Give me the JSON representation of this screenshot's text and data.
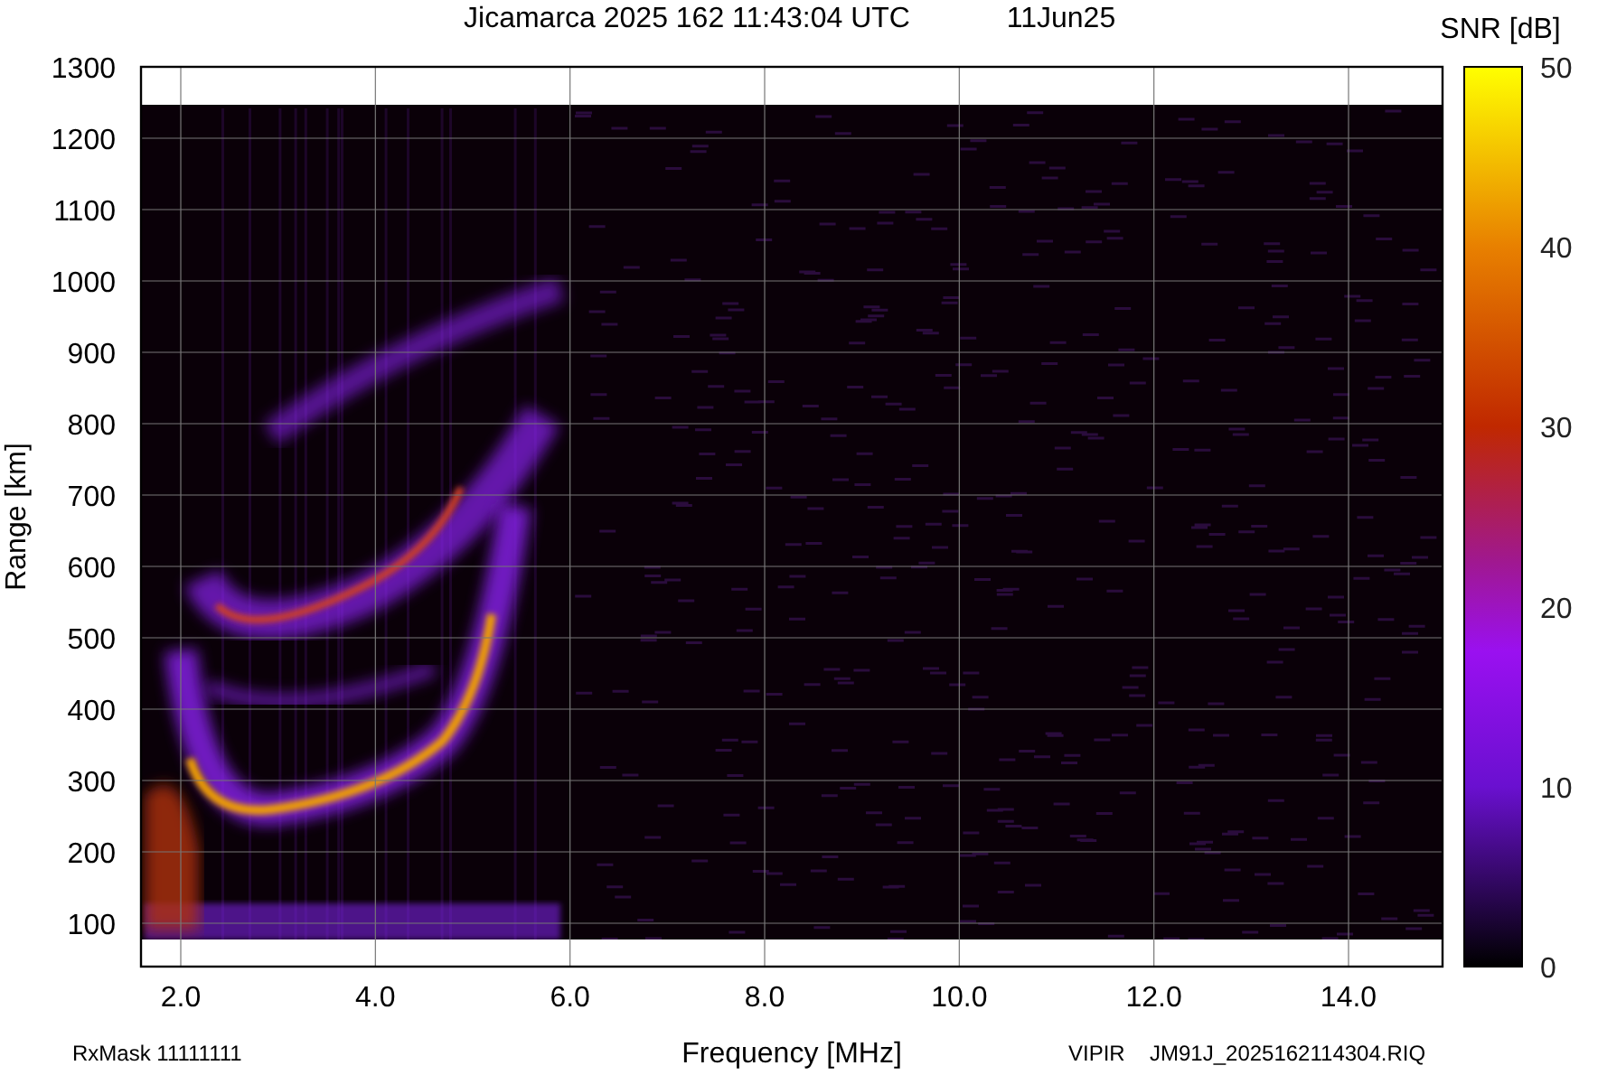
{
  "title": "Jicamarca 2025 162 11:43:04 UTC",
  "date": "11Jun25",
  "colorbar": {
    "label": "SNR [dB]",
    "ticks": [
      "50",
      "40",
      "30",
      "20",
      "10",
      "0"
    ]
  },
  "y_axis": {
    "label": "Range [km]",
    "ticks": [
      "1300",
      "1200",
      "1100",
      "1000",
      "900",
      "800",
      "700",
      "600",
      "500",
      "400",
      "300",
      "200",
      "100"
    ]
  },
  "x_axis": {
    "label": "Frequency [MHz]",
    "ticks": [
      "2.0",
      "4.0",
      "6.0",
      "8.0",
      "10.0",
      "12.0",
      "14.0"
    ]
  },
  "footer": {
    "mask": "RxMask 11111111",
    "receiver": "VIPIR",
    "file": "JM91J_2025162114304.RIQ"
  }
}
